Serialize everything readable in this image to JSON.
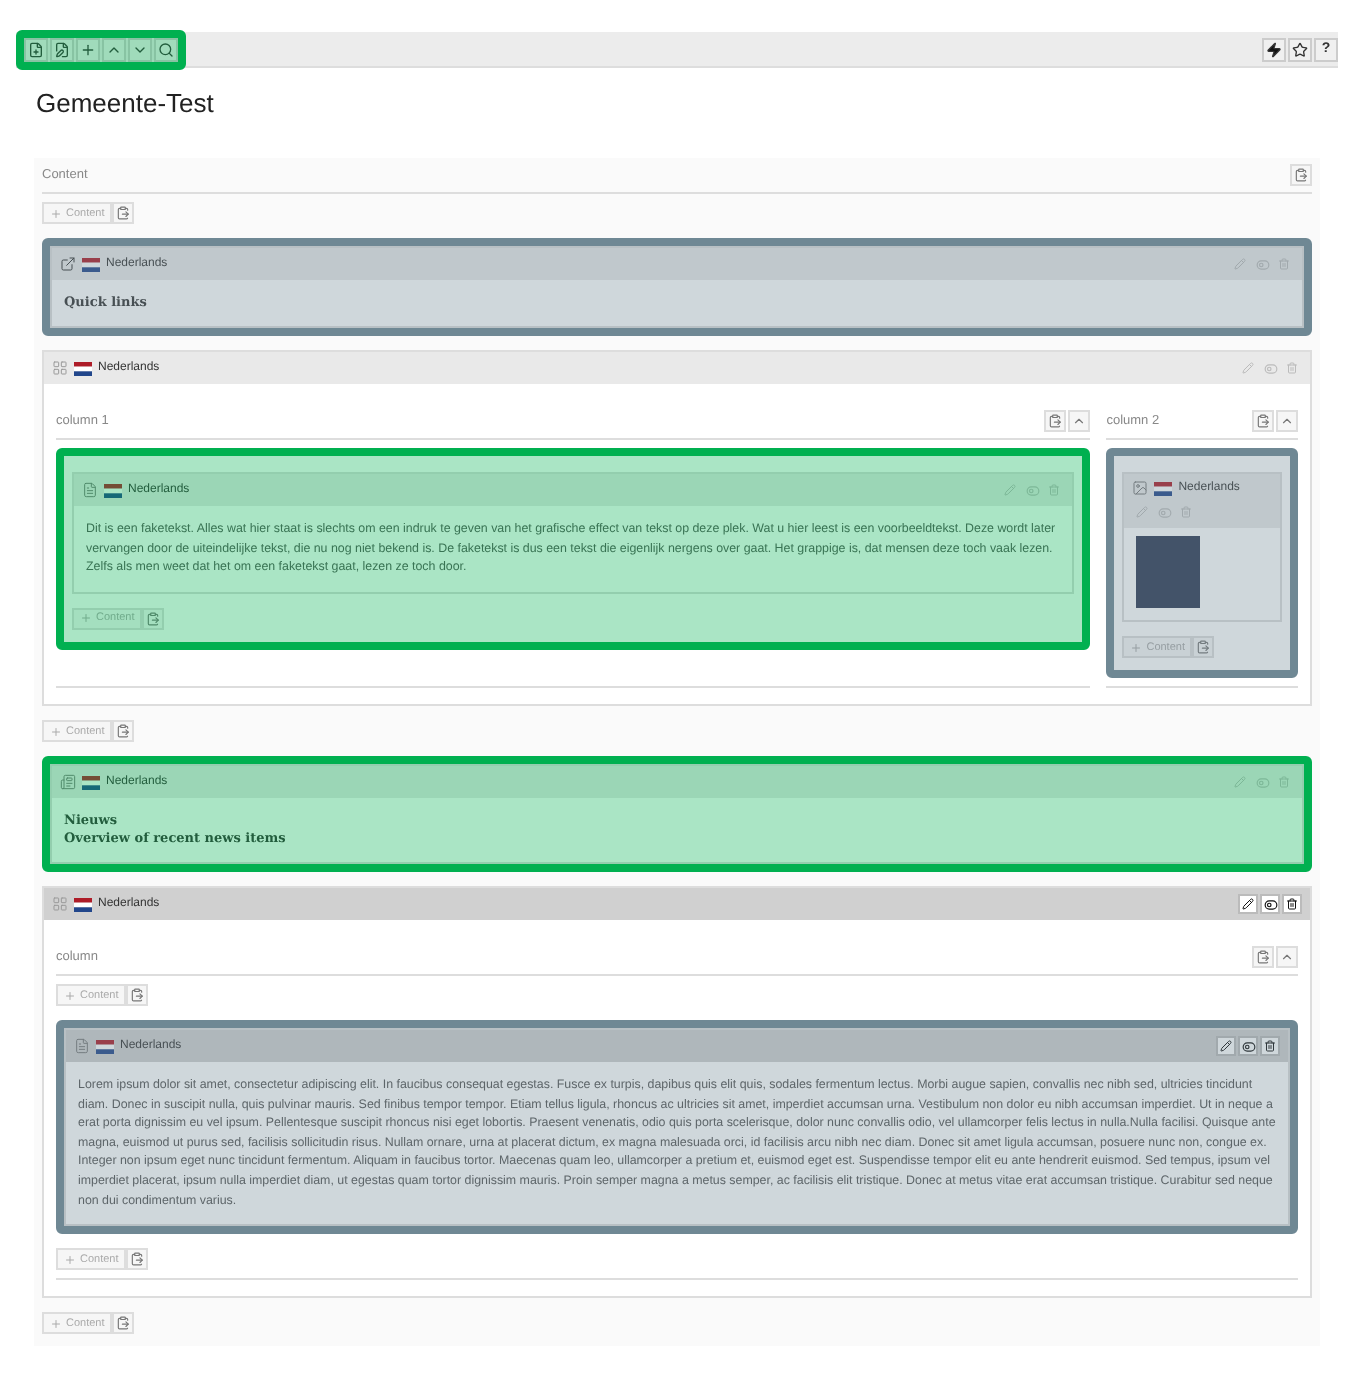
{
  "toolbar": {
    "color": "#00b050",
    "help_label": "?"
  },
  "page_title": "Gemeente-Test",
  "content_area": {
    "label": "Content",
    "items": [
      {
        "kind": "add",
        "label": "Content"
      },
      {
        "kind": "link",
        "language": "Nederlands",
        "active": false,
        "title": "Quick links",
        "color": "#6f8894"
      },
      {
        "kind": "grid",
        "language": "Nederlands",
        "active": false,
        "columns": [
          {
            "label": "column 1",
            "color": "#00b050",
            "items": [
              {
                "kind": "text",
                "language": "Nederlands",
                "active": false,
                "body": "Dit is een faketekst. Alles wat hier staat is slechts om een indruk te geven van het grafische effect van tekst op deze plek. Wat u hier leest is een voorbeeldtekst. Deze wordt later vervangen door de uiteindelijke tekst, die nu nog niet bekend is. De faketekst is dus een tekst die eigenlijk nergens over gaat. Het grappige is, dat mensen deze toch vaak lezen. Zelfs als men weet dat het om een faketekst gaat, lezen ze toch door."
              },
              {
                "kind": "add",
                "label": "Content"
              }
            ]
          },
          {
            "label": "column 2",
            "color": "#6f8894",
            "items": [
              {
                "kind": "image",
                "language": "Nederlands",
                "active": false
              },
              {
                "kind": "add",
                "label": "Content"
              }
            ]
          }
        ]
      },
      {
        "kind": "add",
        "label": "Content"
      },
      {
        "kind": "news",
        "language": "Nederlands",
        "active": false,
        "title": "Nieuws",
        "subtitle": "Overview of recent news items",
        "color": "#00b050"
      },
      {
        "kind": "grid",
        "language": "Nederlands",
        "active": true,
        "columns": [
          {
            "label": "column",
            "items": [
              {
                "kind": "add",
                "label": "Content"
              },
              {
                "kind": "text",
                "language": "Nederlands",
                "active": true,
                "color": "#6f8894",
                "body": "Lorem ipsum dolor sit amet, consectetur adipiscing elit. In faucibus consequat egestas. Fusce ex turpis, dapibus quis elit quis, sodales fermentum lectus. Morbi augue sapien, convallis nec nibh sed, ultricies tincidunt diam. Donec in suscipit nulla, quis pulvinar mauris. Sed finibus tempor tempor. Etiam tellus ligula, rhoncus ac ultricies sit amet, imperdiet accumsan urna. Vestibulum non dolor eu nibh accumsan imperdiet. Ut in neque a erat porta dignissim eu vel ipsum. Pellentesque suscipit rhoncus nisi eget lobortis. Praesent venenatis, odio quis porta scelerisque, dolor nunc convallis odio, vel ullamcorper felis lectus in nulla.Nulla facilisi. Quisque ante magna, euismod ut purus sed, facilisis sollicitudin risus. Nullam ornare, urna at placerat dictum, ex magna malesuada orci, id facilisis arcu nibh nec diam. Donec sit amet ligula accumsan, posuere nunc non, congue ex. Integer non ipsum eget nunc tincidunt fermentum. Aliquam in faucibus tortor. Maecenas quam leo, ullamcorper a pretium et, euismod eget est. Suspendisse tempor elit eu ante hendrerit euismod. Sed tempus, ipsum vel imperdiet placerat, ipsum nulla imperdiet diam, ut egestas quam tortor dignissim mauris. Proin semper magna a metus semper, ac facilisis elit tristique. Donec at metus vitae erat accumsan tristique. Curabitur sed neque non dui condimentum varius."
              },
              {
                "kind": "add",
                "label": "Content"
              }
            ]
          }
        ]
      },
      {
        "kind": "add",
        "label": "Content"
      }
    ]
  }
}
